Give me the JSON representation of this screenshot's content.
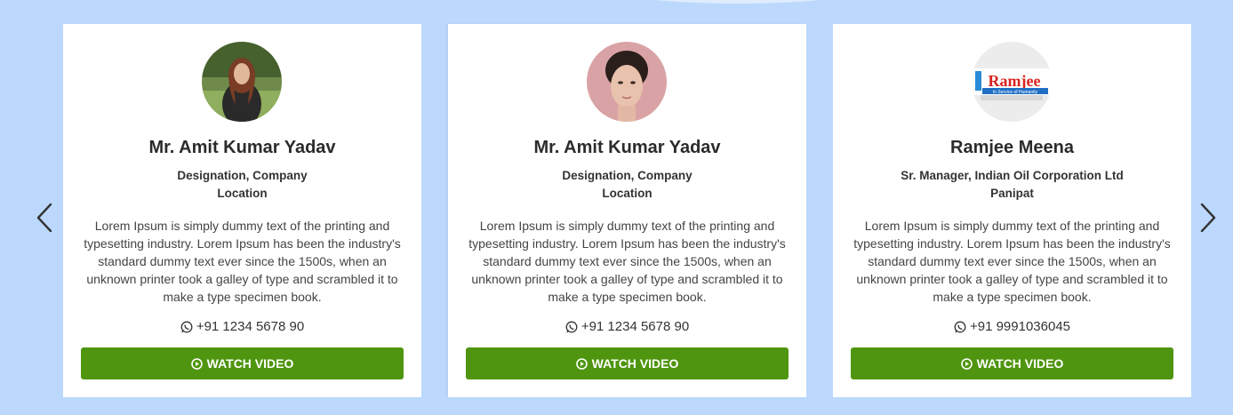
{
  "carousel": {
    "prev_label": "previous",
    "next_label": "next"
  },
  "cards": [
    {
      "name": "Mr. Amit Kumar Yadav",
      "designation": "Designation, Company",
      "location": "Location",
      "description": "Lorem Ipsum is simply dummy text of the printing and typesetting industry. Lorem Ipsum has been the industry's standard dummy text ever since the 1500s, when an unknown printer took a galley of type and scrambled it to make a type specimen book.",
      "phone": "+91 1234 5678 90",
      "button_label": "WATCH VIDEO"
    },
    {
      "name": "Mr. Amit Kumar Yadav",
      "designation": "Designation, Company",
      "location": "Location",
      "description": "Lorem Ipsum is simply dummy text of the printing and typesetting industry. Lorem Ipsum has been the industry's standard dummy text ever since the 1500s, when an unknown printer took a galley of type and scrambled it to make a type specimen book.",
      "phone": "+91 1234 5678 90",
      "button_label": "WATCH VIDEO"
    },
    {
      "name": "Ramjee Meena",
      "designation": "Sr. Manager, Indian Oil Corporation Ltd",
      "location": "Panipat",
      "description": "Lorem Ipsum is simply dummy text of the printing and typesetting industry. Lorem Ipsum has been the industry's standard dummy text ever since the 1500s, when an unknown printer took a galley of type and scrambled it to make a type specimen book.",
      "phone": "+91 9991036045",
      "button_label": "WATCH VIDEO",
      "logo_text": "Ramjee",
      "logo_tagline": "In Service of Humanity"
    }
  ],
  "colors": {
    "background": "#bcd9fd",
    "button": "#4f950f",
    "logo_red": "#d9231f"
  }
}
